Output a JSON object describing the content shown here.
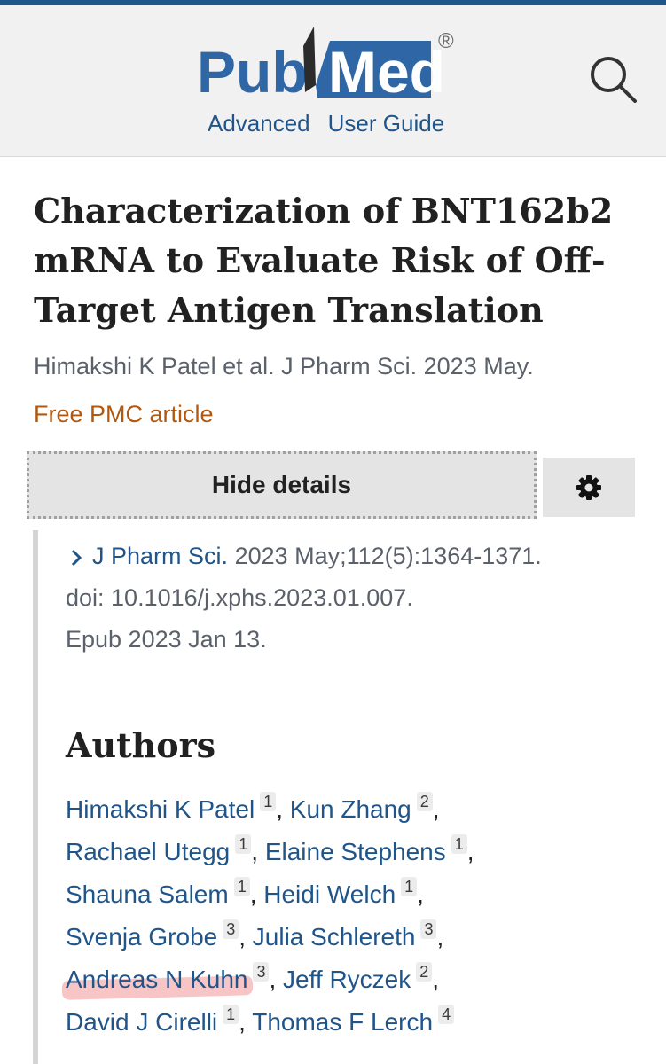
{
  "header": {
    "logo_text_left": "Pub",
    "logo_text_right": "Med",
    "logo_mark": "®",
    "links": [
      "Advanced",
      "User Guide"
    ],
    "search_icon": "search-icon"
  },
  "article": {
    "title": "Characterization of BNT162b2 mRNA to Evaluate Risk of Off-Target Antigen Translation",
    "citation": "Himakshi K Patel et al. J Pharm Sci. 2023 May.",
    "free_pmc": "Free PMC article",
    "hide_details_label": "Hide details",
    "settings_icon": "gear-icon",
    "details": {
      "journal": "J Pharm Sci.",
      "date_pages": "2023 May;112(5):1364-1371.",
      "doi": "doi: 10.1016/j.xphs.2023.01.007.",
      "epub": "Epub 2023 Jan 13."
    }
  },
  "authors_heading": "Authors",
  "authors": [
    {
      "name": "Himakshi K Patel",
      "aff": "1"
    },
    {
      "name": "Kun Zhang",
      "aff": "2"
    },
    {
      "name": "Rachael Utegg",
      "aff": "1"
    },
    {
      "name": "Elaine Stephens",
      "aff": "1"
    },
    {
      "name": "Shauna Salem",
      "aff": "1"
    },
    {
      "name": "Heidi Welch",
      "aff": "1"
    },
    {
      "name": "Svenja Grobe",
      "aff": "3"
    },
    {
      "name": "Julia Schlereth",
      "aff": "3"
    },
    {
      "name": "Andreas N Kuhn",
      "aff": "3"
    },
    {
      "name": "Jeff Ryczek",
      "aff": "2"
    },
    {
      "name": "David J Cirelli",
      "aff": "1"
    },
    {
      "name": "Thomas F Lerch",
      "aff": "4"
    }
  ],
  "colors": {
    "brand": "#20558a",
    "pmc": "#b2580f",
    "text": "#212121",
    "muted": "#5b616b",
    "highlight": "#f09696"
  }
}
